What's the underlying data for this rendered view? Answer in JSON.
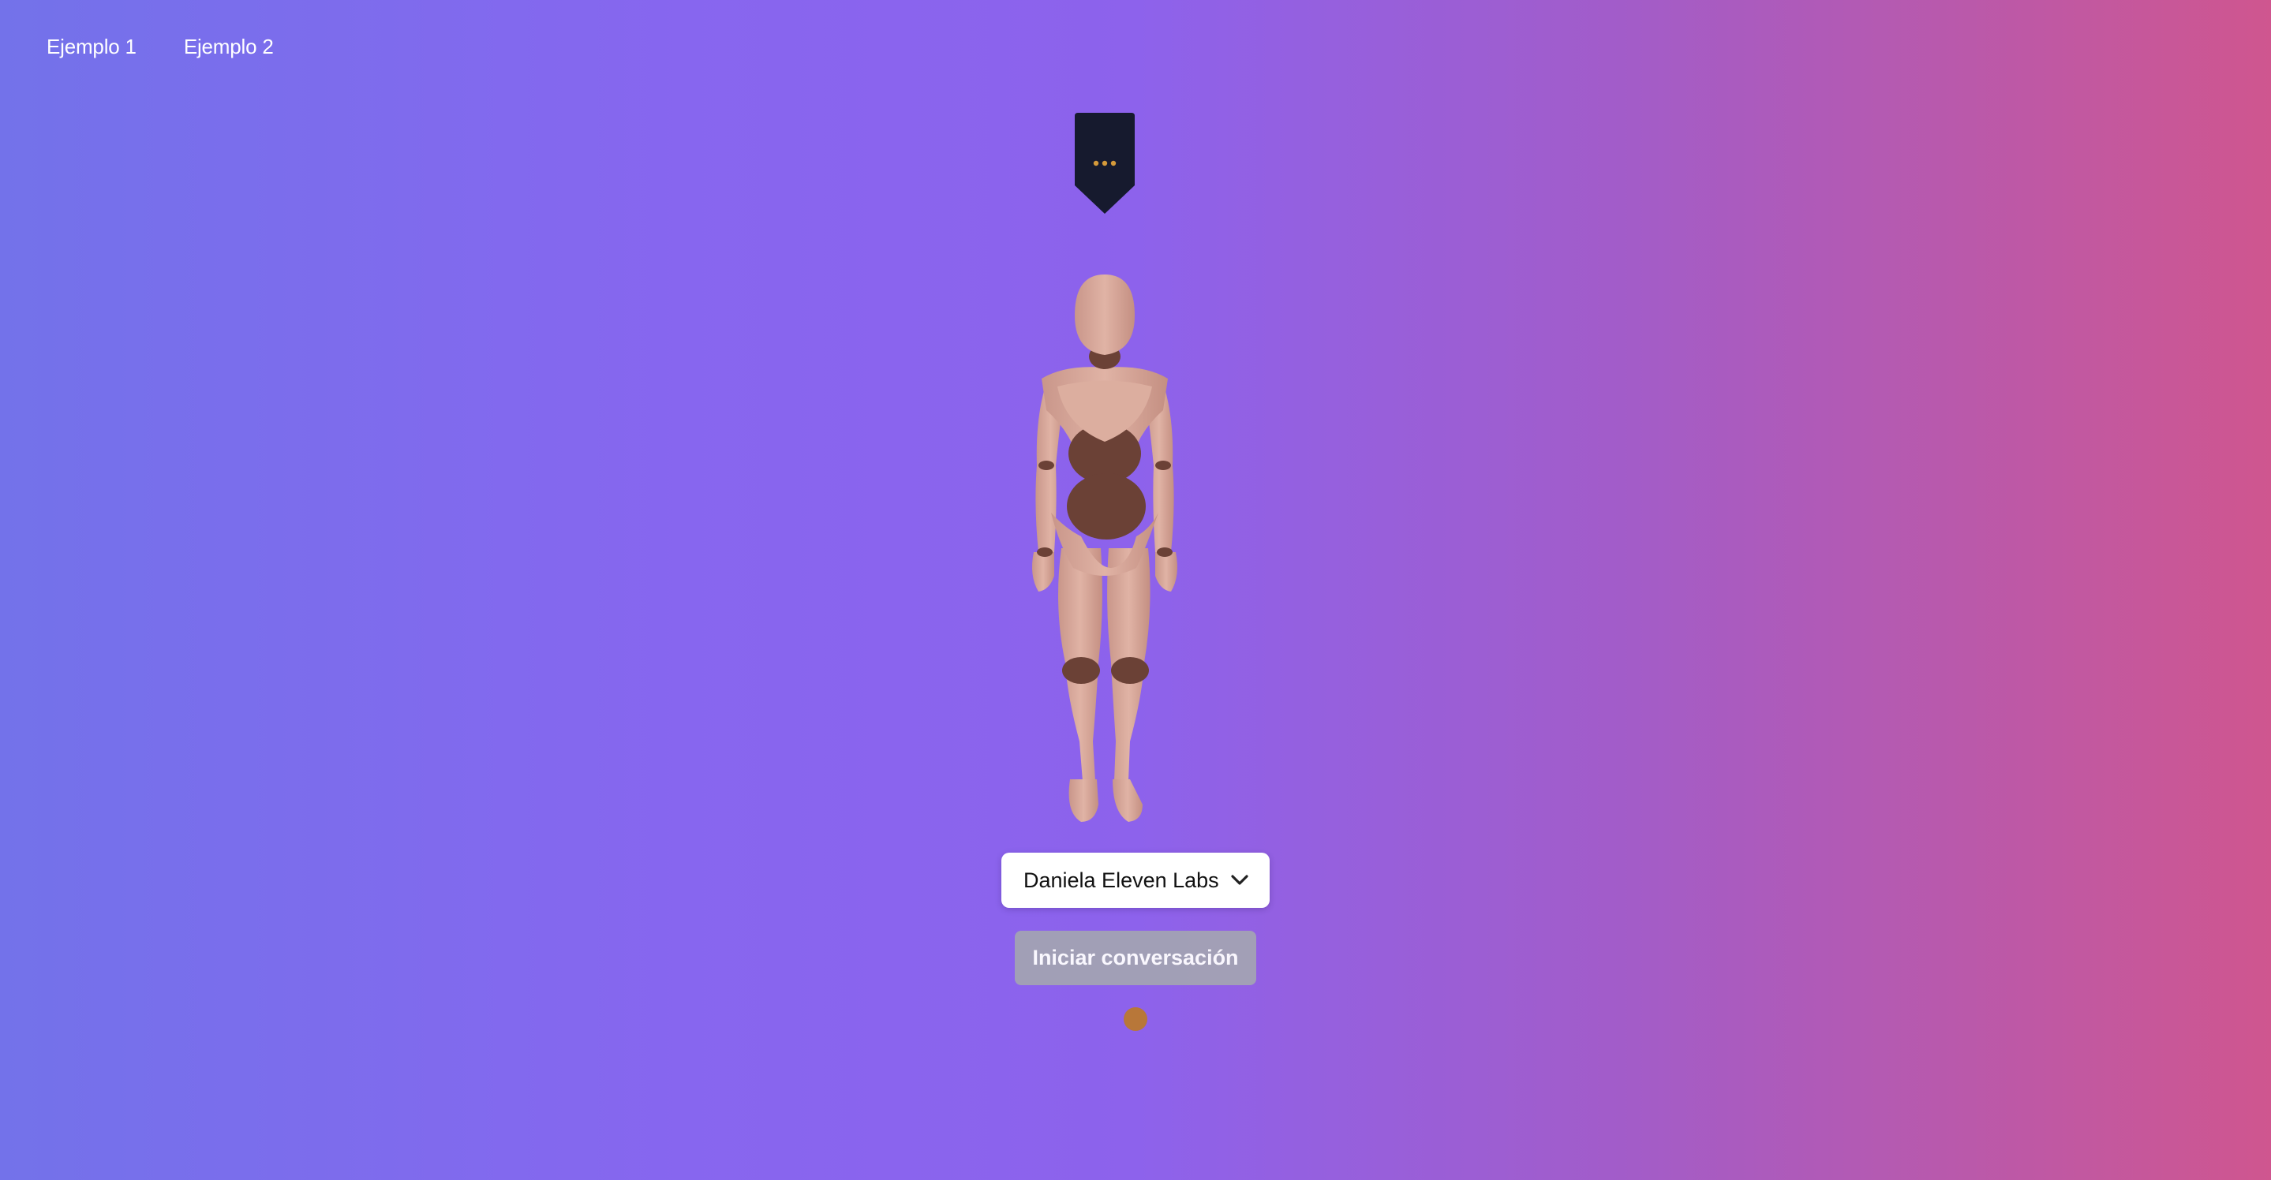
{
  "nav": {
    "items": [
      {
        "label": "Ejemplo 1"
      },
      {
        "label": "Ejemplo 2"
      }
    ]
  },
  "speech_indicator": {
    "icon": "typing-dots-icon",
    "dot_color": "#d59a3a",
    "background": "#161a2e"
  },
  "avatar": {
    "icon": "mannequin-avatar"
  },
  "voice_select": {
    "selected": "Daniela Eleven Labs",
    "icon": "chevron-down-icon"
  },
  "start_button": {
    "label": "Iniciar conversación"
  },
  "status": {
    "color": "#b87739"
  },
  "colors": {
    "gradient_start": "#7372ea",
    "gradient_mid": "#8d62ec",
    "gradient_end": "#cf568f"
  }
}
